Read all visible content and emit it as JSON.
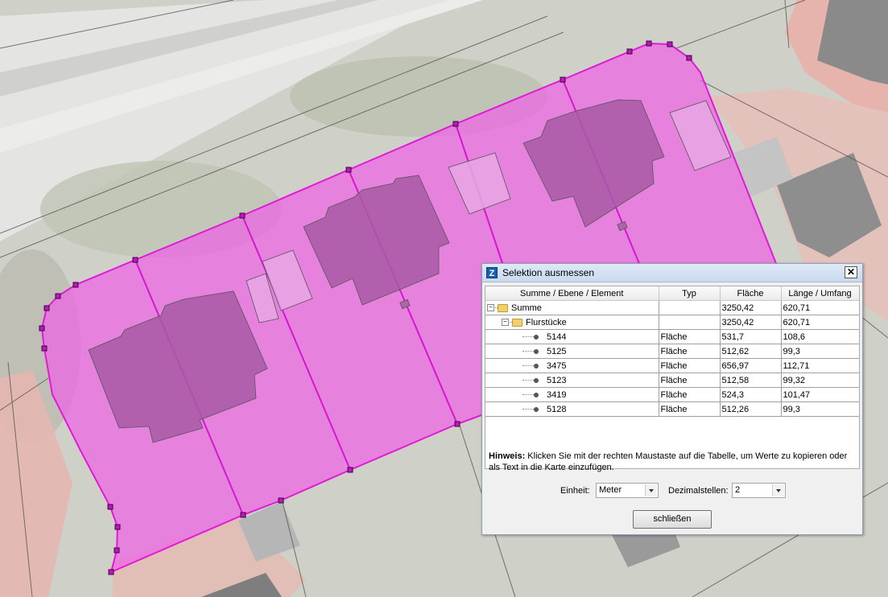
{
  "dialog": {
    "title": "Selektion ausmessen",
    "app_icon": "Z",
    "close_icon": "✕",
    "columns": [
      "Summe / Ebene / Element",
      "Typ",
      "Fläche",
      "Länge / Umfang"
    ],
    "rows": [
      {
        "name": "Summe",
        "typ": "",
        "flaeche": "3250,42",
        "laenge": "620,71"
      },
      {
        "name": "Flurstücke",
        "typ": "",
        "flaeche": "3250,42",
        "laenge": "620,71"
      },
      {
        "name": "5144",
        "typ": "Fläche",
        "flaeche": "531,7",
        "laenge": "108,6"
      },
      {
        "name": "5125",
        "typ": "Fläche",
        "flaeche": "512,62",
        "laenge": "99,3"
      },
      {
        "name": "3475",
        "typ": "Fläche",
        "flaeche": "656,97",
        "laenge": "112,71"
      },
      {
        "name": "5123",
        "typ": "Fläche",
        "flaeche": "512,58",
        "laenge": "99,32"
      },
      {
        "name": "3419",
        "typ": "Fläche",
        "flaeche": "524,3",
        "laenge": "101,47"
      },
      {
        "name": "5128",
        "typ": "Fläche",
        "flaeche": "512,26",
        "laenge": "99,3"
      }
    ],
    "hint_bold": "Hinweis:",
    "hint_text": " Klicken Sie mit der rechten Maustaste auf die Tabelle, um Werte zu kopieren oder als Text in die Karte einzufügen.",
    "unit_label": "Einheit:",
    "unit_value": "Meter",
    "decimals_label": "Dezimalstellen:",
    "decimals_value": "2",
    "close_button": "schließen"
  },
  "colors": {
    "selection_fill": "#ee62e6",
    "selection_stroke": "#e01ad6",
    "building": "#a85aa6"
  }
}
